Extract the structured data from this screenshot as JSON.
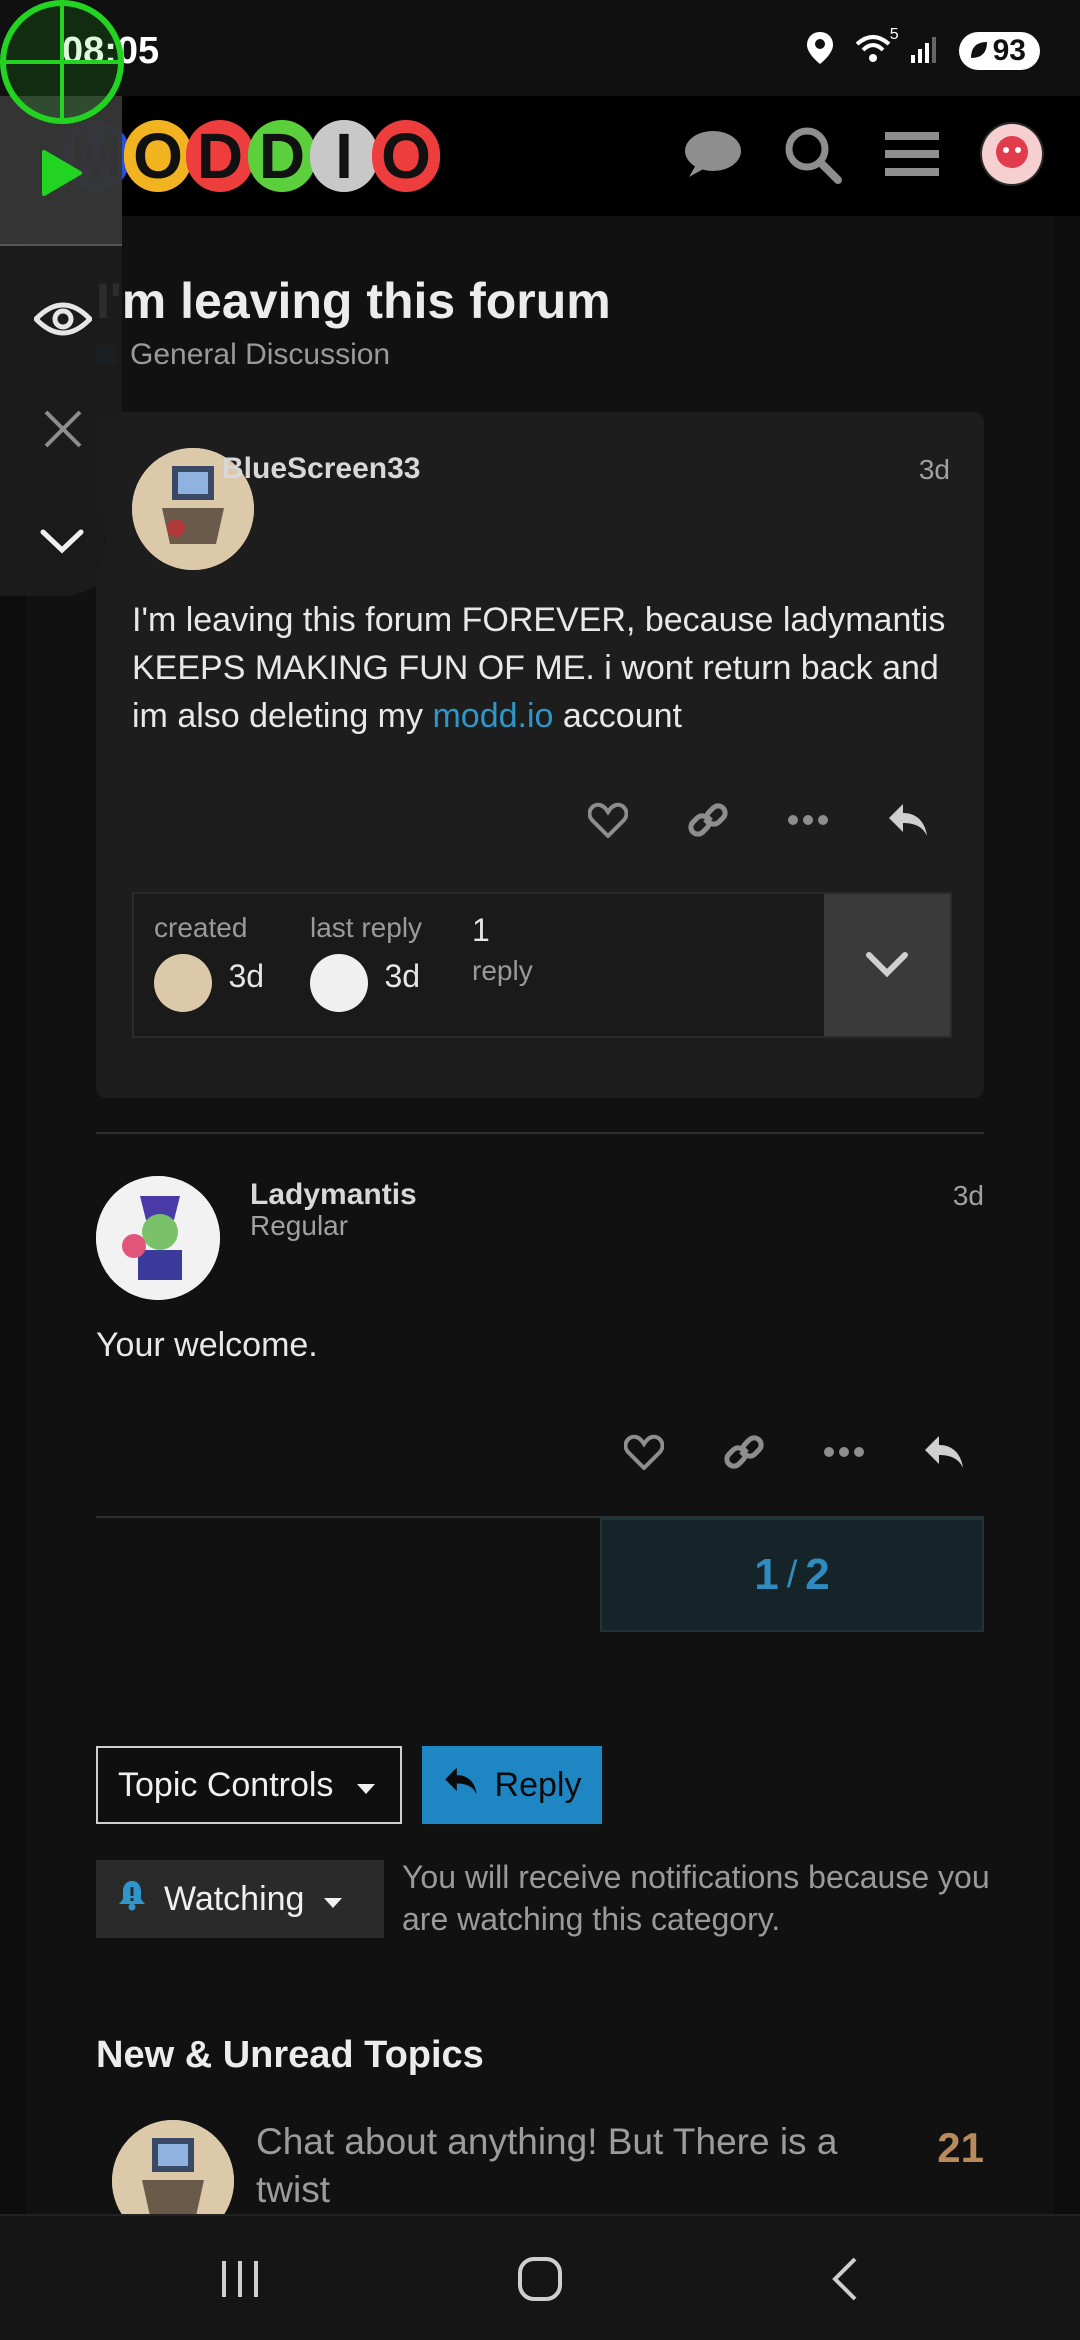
{
  "status": {
    "time": "08:05",
    "wifi_badge": "5",
    "battery": "93"
  },
  "header": {
    "logo_letters": [
      "M",
      "O",
      "D",
      "D",
      "I",
      "O"
    ],
    "icons": [
      "chat-icon",
      "search-icon",
      "menu-icon",
      "user-avatar"
    ]
  },
  "topic": {
    "title": "I'm leaving this forum",
    "category": "General Discussion"
  },
  "original_post": {
    "username": "BlueScreen33",
    "date": "3d",
    "body_before_link": "I'm leaving this forum FOREVER, because ladymantis KEEPS MAKING FUN OF ME. i wont return back and im also deleting my ",
    "link_text": "modd.io",
    "body_after_link": " account",
    "meta": {
      "created_label": "created",
      "created_value": "3d",
      "last_reply_label": "last reply",
      "last_reply_value": "3d",
      "replies_count": "1",
      "replies_label": "reply"
    }
  },
  "reply_post": {
    "username": "Ladymantis",
    "user_title": "Regular",
    "date": "3d",
    "body": "Your welcome."
  },
  "progress": {
    "current": "1",
    "separator": "/",
    "total": "2"
  },
  "controls": {
    "topic_controls_label": "Topic Controls",
    "reply_label": "Reply",
    "watching_label": "Watching",
    "watching_description": "You will receive notifications because you are watching this category."
  },
  "suggested": {
    "section_title": "New & Unread Topics",
    "topics": [
      {
        "title": "Chat about anything! But There is a twist",
        "count": "21"
      }
    ]
  },
  "colors": {
    "accent": "#1e86c2",
    "link": "#2e96c9",
    "count": "#b98a5c",
    "overlay_green": "#22d322"
  }
}
